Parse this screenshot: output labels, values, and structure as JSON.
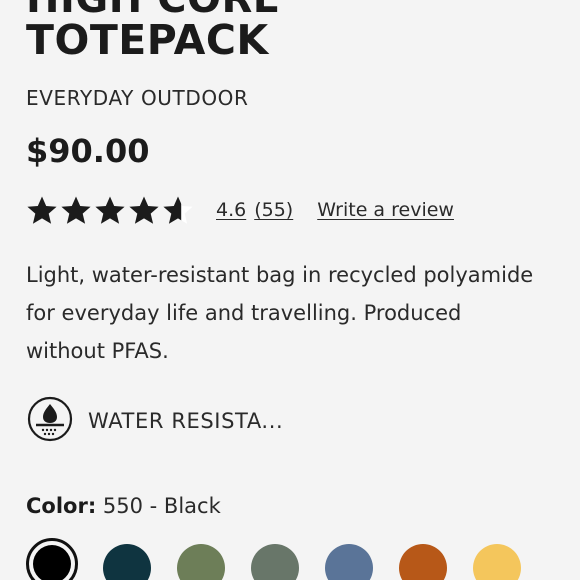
{
  "product": {
    "title_partial_above": "HIGH CORE",
    "title": "TOTEPACK",
    "brand_line": "EVERYDAY OUTDOOR",
    "price": "$90.00",
    "rating": {
      "value": 4.6,
      "value_text": "4.6",
      "count_text": "(55)",
      "stars_max": 5,
      "star_color": "#1b1b1b"
    },
    "write_review": "Write a review",
    "description": "Light, water-resistant bag in recycled polyamide for everyday life and travelling. Produced without PFAS.",
    "feature": {
      "icon": "water-resistant-icon",
      "label": "WATER RESISTA..."
    },
    "color": {
      "label": "Color:",
      "selected": "550 - Black",
      "swatches": [
        {
          "name": "black",
          "hex": "#000000",
          "selected": true
        },
        {
          "name": "dark-teal",
          "hex": "#0f3440",
          "selected": false
        },
        {
          "name": "olive-green",
          "hex": "#6d7e58",
          "selected": false
        },
        {
          "name": "grey-green",
          "hex": "#687669",
          "selected": false
        },
        {
          "name": "slate-blue",
          "hex": "#5a7498",
          "selected": false
        },
        {
          "name": "rust-orange",
          "hex": "#b75818",
          "selected": false
        },
        {
          "name": "yellow",
          "hex": "#f4c65c",
          "selected": false
        }
      ]
    }
  }
}
